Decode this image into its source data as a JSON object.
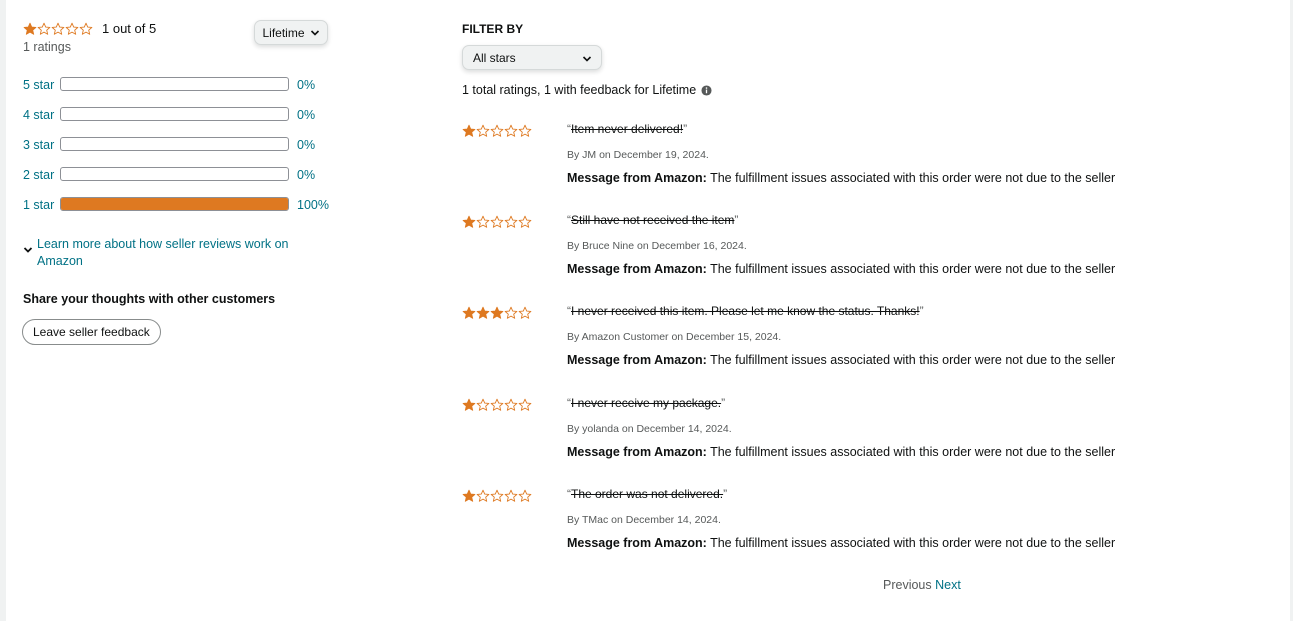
{
  "summary": {
    "rating_stars": 1,
    "rating_text": "1 out of 5",
    "ratings_count": "1 ratings",
    "period_select": "Lifetime"
  },
  "histogram": [
    {
      "label": "5 star",
      "percent_text": "0%",
      "fraction": 0
    },
    {
      "label": "4 star",
      "percent_text": "0%",
      "fraction": 0
    },
    {
      "label": "3 star",
      "percent_text": "0%",
      "fraction": 0
    },
    {
      "label": "2 star",
      "percent_text": "0%",
      "fraction": 0
    },
    {
      "label": "1 star",
      "percent_text": "100%",
      "fraction": 1
    }
  ],
  "learn_more": "Learn more about how seller reviews work on Amazon",
  "share": {
    "title": "Share your thoughts with other customers",
    "button": "Leave seller feedback"
  },
  "filter": {
    "title": "FILTER BY",
    "selected": "All stars",
    "total_text": "1 total ratings, 1 with feedback for Lifetime"
  },
  "reviews": [
    {
      "stars": 1,
      "text": "Item never delivered!",
      "by": "By JM on December 19, 2024.",
      "msg_label": "Message from Amazon:",
      "msg_text": " The fulfillment issues associated with this order were not due to the seller"
    },
    {
      "stars": 1,
      "text": "Still have not received the item",
      "by": "By Bruce Nine on December 16, 2024.",
      "msg_label": "Message from Amazon:",
      "msg_text": " The fulfillment issues associated with this order were not due to the seller"
    },
    {
      "stars": 3,
      "text": "I never received this item. Please let me know the status. Thanks!",
      "by": "By Amazon Customer on December 15, 2024.",
      "msg_label": "Message from Amazon:",
      "msg_text": " The fulfillment issues associated with this order were not due to the seller"
    },
    {
      "stars": 1,
      "text": "I never receive my package.",
      "by": "By yolanda on December 14, 2024.",
      "msg_label": "Message from Amazon:",
      "msg_text": " The fulfillment issues associated with this order were not due to the seller"
    },
    {
      "stars": 1,
      "text": "The order was not delivered.",
      "by": "By TMac on December 14, 2024.",
      "msg_label": "Message from Amazon:",
      "msg_text": " The fulfillment issues associated with this order were not due to the seller"
    }
  ],
  "pager": {
    "previous": "Previous",
    "next": "Next"
  },
  "colors": {
    "star": "#de7921",
    "link": "#007185",
    "muted": "#565959"
  }
}
